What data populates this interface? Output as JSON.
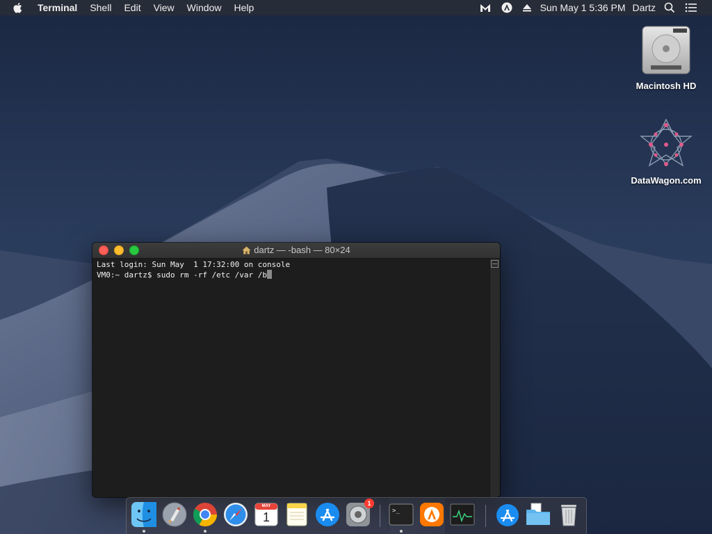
{
  "menubar": {
    "apple_icon": "apple-icon",
    "app_name": "Terminal",
    "menus": [
      "Shell",
      "Edit",
      "View",
      "Window",
      "Help"
    ],
    "status_icons": [
      "malwarebytes-icon",
      "avast-icon",
      "eject-icon"
    ],
    "clock": "Sun May 1  5:36 PM",
    "user": "Dartz",
    "search_icon": "spotlight-icon",
    "notification_icon": "notification-center-icon"
  },
  "desktop": {
    "icons": [
      {
        "label": "Macintosh HD",
        "icon": "hard-drive-icon"
      },
      {
        "label": "DataWagon.com",
        "icon": "datawagon-logo-icon"
      }
    ]
  },
  "terminal": {
    "title": "dartz — -bash — 80×24",
    "lines": [
      "Last login: Sun May  1 17:32:00 on console",
      "VM0:~ dartz$ sudo rm -rf /etc /var /b"
    ]
  },
  "dock": {
    "items": [
      {
        "name": "Finder",
        "icon": "finder-icon",
        "running": true
      },
      {
        "name": "Launchpad",
        "icon": "launchpad-icon",
        "running": false
      },
      {
        "name": "Google Chrome",
        "icon": "chrome-icon",
        "running": true
      },
      {
        "name": "Safari",
        "icon": "safari-icon",
        "running": false
      },
      {
        "name": "Calendar",
        "icon": "calendar-icon",
        "running": false,
        "month": "MAY",
        "day": "1"
      },
      {
        "name": "Notes",
        "icon": "notes-icon",
        "running": false
      },
      {
        "name": "App Store",
        "icon": "app-store-icon",
        "running": false
      },
      {
        "name": "System Preferences",
        "icon": "system-preferences-icon",
        "running": false,
        "badge": "1"
      },
      {
        "name": "Terminal",
        "icon": "terminal-icon",
        "running": true
      },
      {
        "name": "Avast",
        "icon": "avast-app-icon",
        "running": false
      },
      {
        "name": "Activity Monitor",
        "icon": "activity-monitor-icon",
        "running": false
      },
      {
        "name": "Downloads",
        "icon": "downloads-stack-icon",
        "running": false
      },
      {
        "name": "Documents",
        "icon": "folder-stack-icon",
        "running": false
      },
      {
        "name": "Trash",
        "icon": "trash-icon",
        "running": false
      }
    ]
  },
  "colors": {
    "menubar_bg": "#282c38",
    "terminal_bg": "#1d1d1d",
    "close": "#fe5f57",
    "minimize": "#febc2e",
    "maximize": "#28c840"
  }
}
